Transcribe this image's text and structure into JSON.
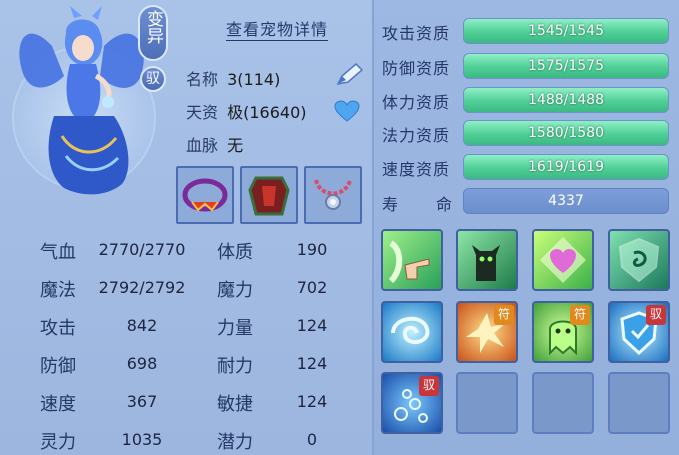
{
  "pet": {
    "variant_tag": "变异",
    "mount_tag": "驭",
    "detail_link": "查看宠物详情",
    "name_label": "名称",
    "name_value": "3(114)",
    "talent_label": "天资",
    "talent_value": "极(16640)",
    "bloodline_label": "血脉",
    "bloodline_value": "无"
  },
  "equipment": [
    {
      "slot": "necklace-ring",
      "icon": "ring-collar-icon"
    },
    {
      "slot": "armor",
      "icon": "armor-icon"
    },
    {
      "slot": "collar",
      "icon": "chain-collar-icon"
    }
  ],
  "stats": {
    "hp": {
      "label": "气血",
      "value": "2770/2770"
    },
    "mp": {
      "label": "魔法",
      "value": "2792/2792"
    },
    "atk": {
      "label": "攻击",
      "value": "842"
    },
    "def": {
      "label": "防御",
      "value": "698"
    },
    "spd": {
      "label": "速度",
      "value": "367"
    },
    "spirit": {
      "label": "灵力",
      "value": "1035"
    },
    "con": {
      "label": "体质",
      "value": "190"
    },
    "mag": {
      "label": "魔力",
      "value": "702"
    },
    "str": {
      "label": "力量",
      "value": "124"
    },
    "end": {
      "label": "耐力",
      "value": "124"
    },
    "agi": {
      "label": "敏捷",
      "value": "124"
    },
    "pot": {
      "label": "潜力",
      "value": "0"
    }
  },
  "aptitudes": [
    {
      "label": "攻击资质",
      "value": "1545/1545",
      "ratio": 1.0
    },
    {
      "label": "防御资质",
      "value": "1575/1575",
      "ratio": 1.0
    },
    {
      "label": "体力资质",
      "value": "1488/1488",
      "ratio": 1.0
    },
    {
      "label": "法力资质",
      "value": "1580/1580",
      "ratio": 1.0
    },
    {
      "label": "速度资质",
      "value": "1619/1619",
      "ratio": 1.0
    }
  ],
  "lifespan": {
    "label1": "寿",
    "label2": "命",
    "value": "4337"
  },
  "skills": [
    {
      "icon": "pointing-hand-icon",
      "badge": ""
    },
    {
      "icon": "black-cat-icon",
      "badge": ""
    },
    {
      "icon": "heart-shield-icon",
      "badge": ""
    },
    {
      "icon": "swirl-shield-icon",
      "badge": ""
    },
    {
      "icon": "whirlwind-icon",
      "badge": ""
    },
    {
      "icon": "burst-icon",
      "badge": "符"
    },
    {
      "icon": "ghost-icon",
      "badge": "符"
    },
    {
      "icon": "blue-shield-icon",
      "badge": "驭"
    },
    {
      "icon": "bubbles-icon",
      "badge": "驭"
    },
    {
      "icon": "empty-slot",
      "badge": ""
    },
    {
      "icon": "empty-slot",
      "badge": ""
    },
    {
      "icon": "empty-slot",
      "badge": ""
    }
  ],
  "colors": {
    "bar_fill": "#4fcf96",
    "panel_bg": "#a9c2e8",
    "badge_fu": "#e08a1e",
    "badge_yu": "#c9363a"
  }
}
